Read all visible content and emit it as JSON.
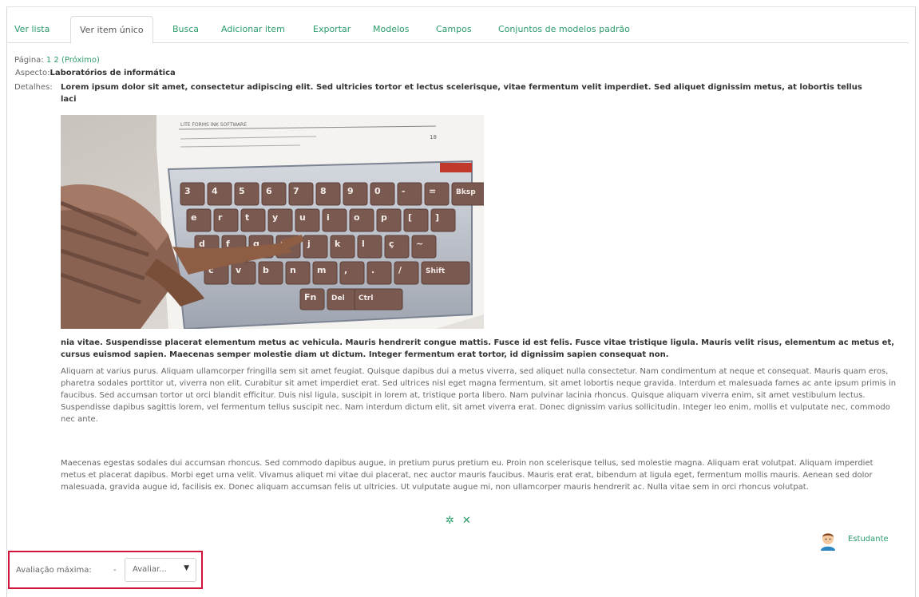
{
  "tabs": [
    "Ver lista",
    "Ver item único",
    "Busca",
    "Adicionar item",
    "Exportar",
    "Modelos",
    "Campos",
    "Conjuntos de modelos padrão"
  ],
  "pager": {
    "label": "Página:",
    "page1": "1",
    "page2": "2",
    "next": "(Próximo)"
  },
  "fields": {
    "aspect_label": "Aspecto:",
    "aspect_value": "Laboratórios de informática",
    "details_label": "Detalhes:",
    "details_line1": "Lorem ipsum dolor sit amet, consectetur adipiscing elit. Sed ultricies tortor et lectus scelerisque, vitae fermentum velit imperdiet. Sed aliquet dignissim metus, at lobortis tellus",
    "details_line2": "laci",
    "details_after_image": "nia vitae. Suspendisse placerat elementum metus ac vehicula. Mauris hendrerit congue mattis. Fusce id est felis. Fusce vitae tristique ligula. Mauris velit risus, elementum ac metus et, cursus euismod sapien. Maecenas semper molestie diam ut dictum. Integer fermentum erat tortor, id dignissim sapien consequat non."
  },
  "paragraphs": [
    "Aliquam at varius purus. Aliquam ullamcorper fringilla sem sit amet feugiat. Quisque dapibus dui a metus viverra, sed aliquet nulla consectetur. Nam condimentum at neque et consequat. Mauris quam eros, pharetra sodales porttitor ut, viverra non elit. Curabitur sit amet imperdiet erat. Sed ultrices nisl eget magna fermentum, sit amet lobortis neque gravida. Interdum et malesuada fames ac ante ipsum primis in faucibus. Sed accumsan tortor ut orci blandit efficitur. Duis nisl ligula, suscipit in lorem at, tristique porta libero. Nam pulvinar lacinia rhoncus. Quisque aliquam viverra enim, sit amet vestibulum lectus. Suspendisse dapibus sagittis lorem, vel fermentum tellus suscipit nec. Nam interdum dictum elit, sit amet viverra erat. Donec dignissim varius sollicitudin. Integer leo enim, mollis et vulputate nec, commodo nec ante.",
    "Maecenas egestas sodales dui accumsan rhoncus. Sed commodo dapibus augue, in pretium purus pretium eu. Proin non scelerisque tellus, sed molestie magna. Aliquam erat volutpat. Aliquam imperdiet metus et placerat dapibus. Morbi eget urna velit. Vivamus aliquet mi vitae dui placerat, nec auctor mauris faucibus. Mauris erat erat, bibendum at ligula eget, fermentum mollis mauris. Aenean sed dolor malesuada, gravida augue id, facilisis ex. Donec aliquam accumsan felis ut ultricies. Ut vulputate augue mi, non ullamcorper mauris hendrerit ac. Nulla vitae sem in orci rhoncus volutpat."
  ],
  "image": {
    "keys_row1": [
      "3",
      "4",
      "5",
      "6",
      "7",
      "8",
      "9",
      "0",
      "-",
      "=",
      "Bksp"
    ],
    "keys_row2": [
      "e",
      "r",
      "t",
      "y",
      "u",
      "i",
      "o",
      "p",
      "[",
      "]"
    ],
    "keys_row3": [
      "d",
      "f",
      "g",
      "h",
      "j",
      "k",
      "l",
      "ç",
      "~"
    ],
    "keys_row4": [
      "c",
      "v",
      "b",
      "n",
      "m",
      ",",
      ".",
      "/",
      "Shift"
    ],
    "keys_row5": [
      "Fn",
      "Del",
      "Ctrl"
    ],
    "sheet_text": "LITE FORMS INK SOFTWARE",
    "sheet_num": "18"
  },
  "actions": {
    "edit_glyph": "✲",
    "delete_glyph": "✕"
  },
  "user": {
    "name": "Estudante"
  },
  "rating": {
    "label": "Avaliação máxima:",
    "value": "-",
    "select": "Avaliar...",
    "caret": "▼"
  }
}
